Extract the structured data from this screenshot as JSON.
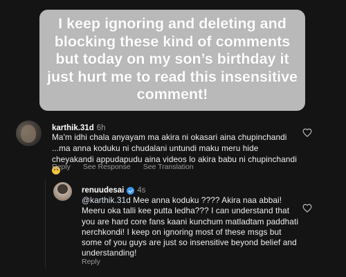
{
  "caption": {
    "text": "I keep ignoring and deleting and blocking these kind of comments but today on my son’s birthday it just hurt me to read this insensitive comment!"
  },
  "comment1": {
    "username": "karthik.31d",
    "time": "6h",
    "text": "Ma'm idhi chala anyayam ma akira ni okasari aina chupinchandi ...ma anna koduku ni chudalani untundi maku meru hide cheyakandi appudapudu aina videos lo akira babu ni chupinchandi",
    "emoji": "pensive-face",
    "actions": {
      "reply": "Reply",
      "see_response": "See Response",
      "see_translation": "See Translation"
    }
  },
  "comment2": {
    "username": "renuudesai",
    "time": "4s",
    "verified": true,
    "mention": "@karthik.31d",
    "text": " Mee anna koduku ???? Akira naa abbai! Meeru oka talli kee putta ledha??? I can understand that you are hard core fans kaani kunchum matladtam paddhati nerchkondi! I keep on ignoring most of these msgs but some of you guys are just so insensitive beyond belief and understanding!",
    "actions": {
      "reply": "Reply"
    }
  },
  "icons": {
    "like": "heart-outline-icon",
    "verified": "verified-badge-icon"
  },
  "colors": {
    "background": "#141414",
    "caption_bg": "#b9b9b9",
    "verified": "#3897f0",
    "meta": "#9a9a9a"
  }
}
